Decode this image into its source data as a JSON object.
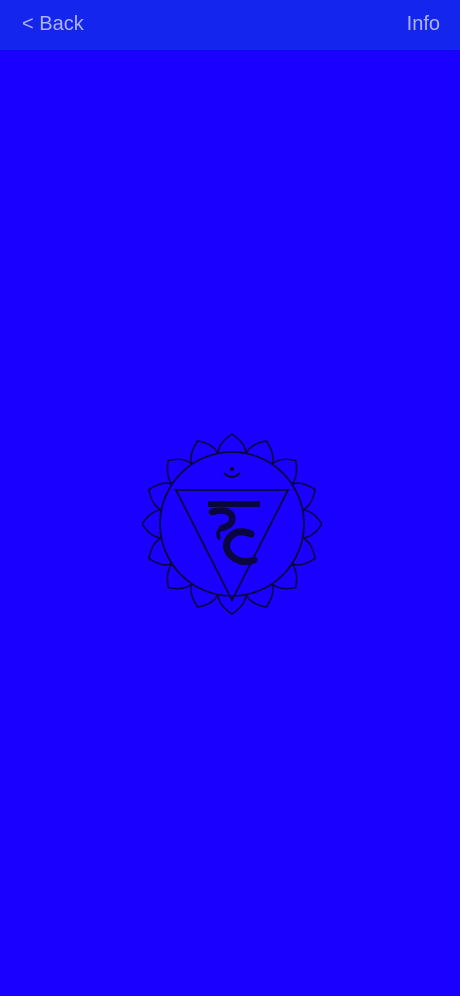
{
  "nav": {
    "back_label": "< Back",
    "info_label": "Info"
  },
  "symbol": {
    "icon": "throat-chakra-symbol-icon",
    "petals": 16,
    "glyph": "हं"
  },
  "colors": {
    "navbar_bg": "#1426EE",
    "page_bg": "#1A00FF",
    "nav_text": "#AEB4F4",
    "symbol_stroke": "#0A0640"
  }
}
